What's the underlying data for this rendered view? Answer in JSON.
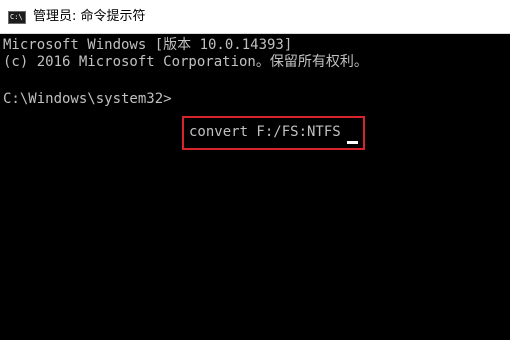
{
  "window": {
    "title": "管理员: 命令提示符",
    "icon_text": "C:\\",
    "icon": "cmd-icon"
  },
  "console": {
    "line1": "Microsoft Windows [版本 10.0.14393]",
    "line2": "(c) 2016 Microsoft Corporation。保留所有权利。",
    "prompt": "C:\\Windows\\system32>",
    "command": "convert F:/FS:NTFS"
  },
  "colors": {
    "console_bg": "#000000",
    "console_text": "#c0c0c0",
    "highlight_border": "#d7242c"
  }
}
